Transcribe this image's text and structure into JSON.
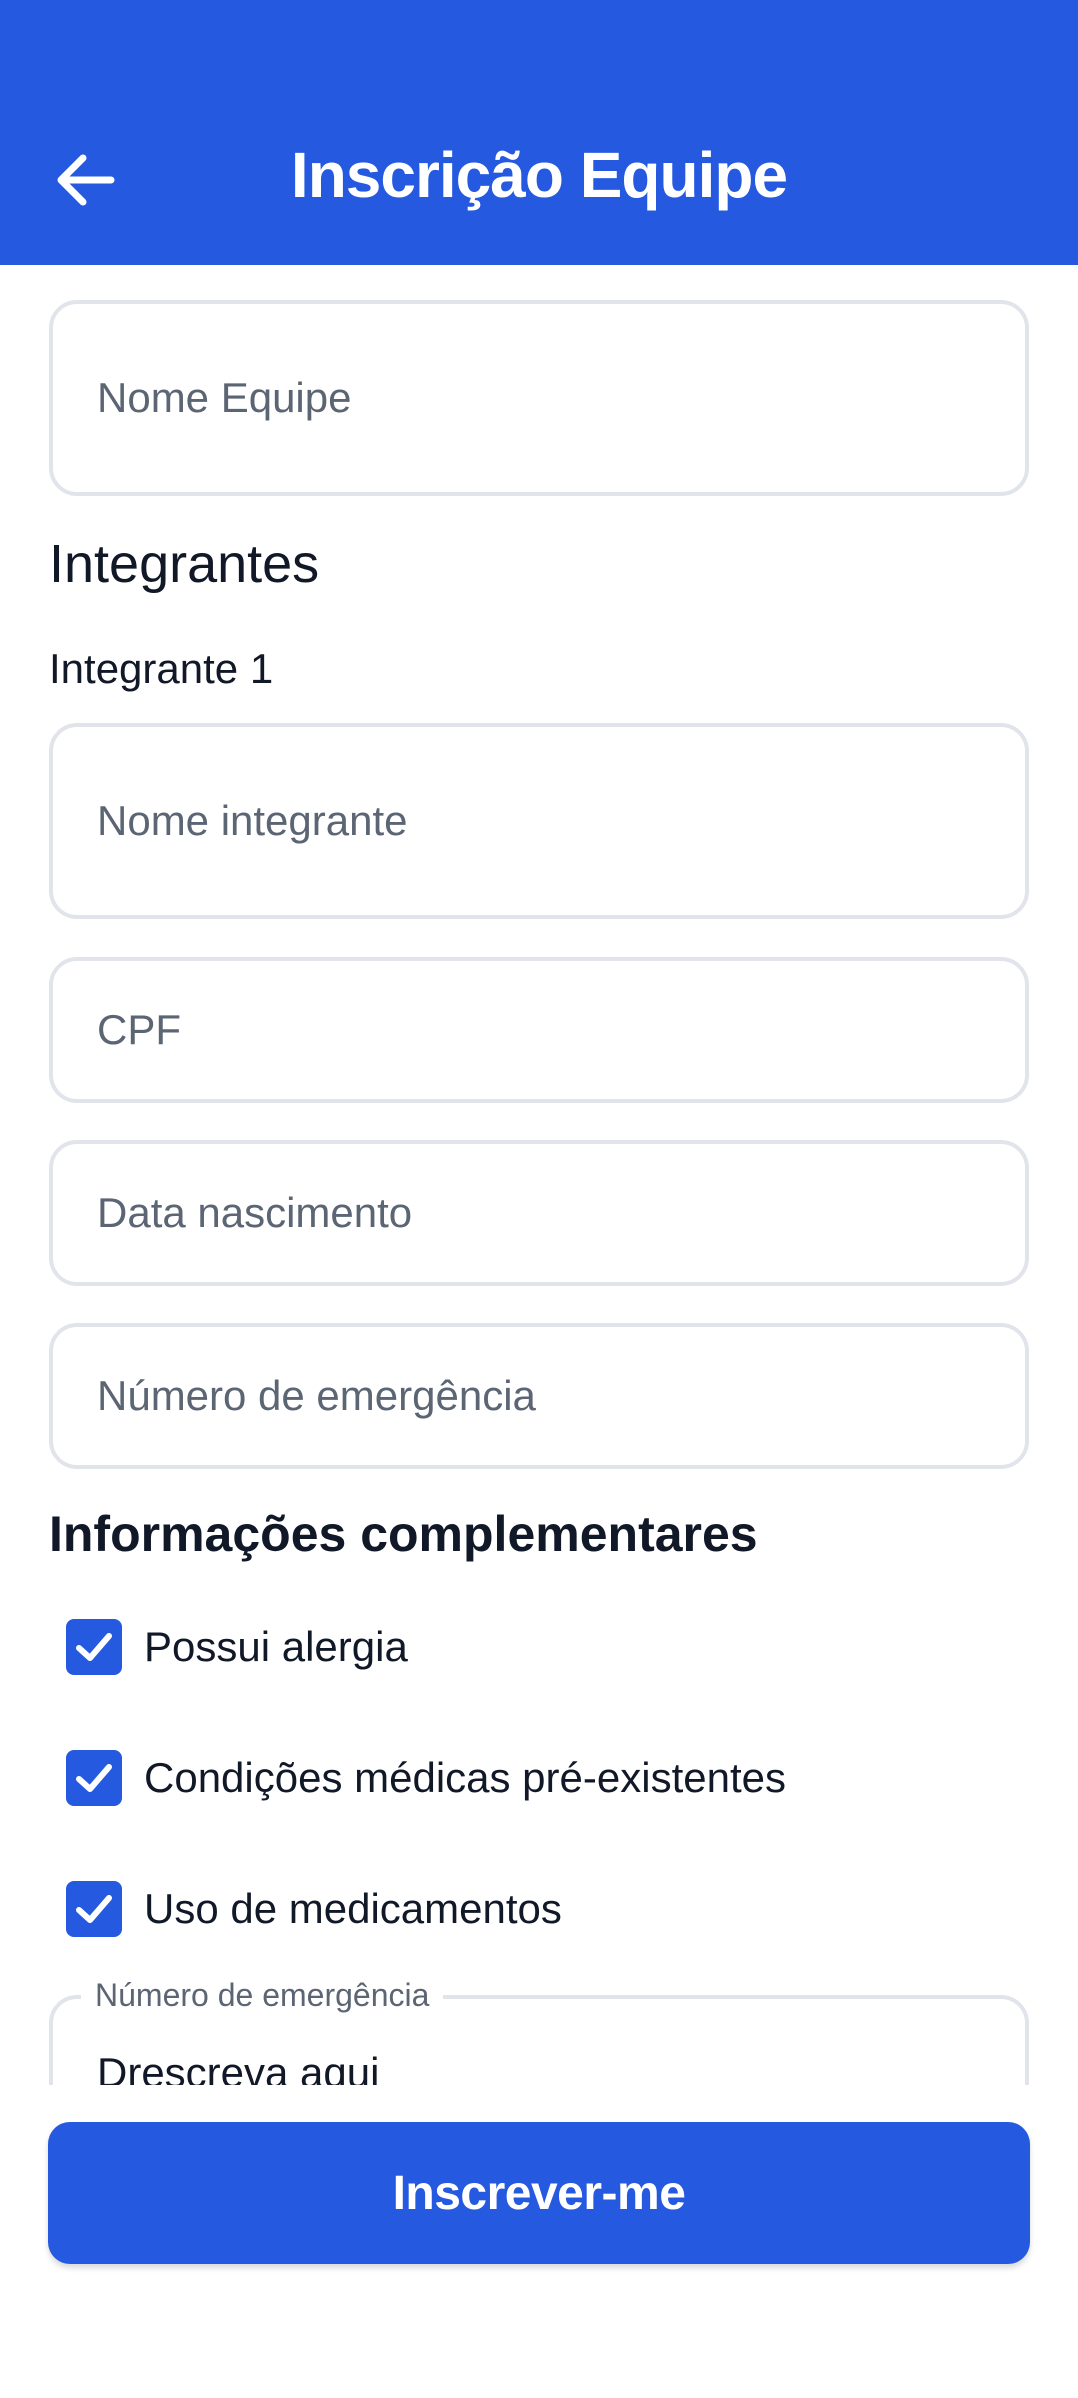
{
  "header": {
    "title": "Inscrição Equipe",
    "back_icon": "arrow-left-icon",
    "background": "#2459E0"
  },
  "form": {
    "team_name_placeholder": "Nome Equipe",
    "members_title": "Integrantes",
    "member_label": "Integrante 1",
    "member_name_placeholder": "Nome integrante",
    "cpf_placeholder": "CPF",
    "birth_date_placeholder": "Data nascimento",
    "emergency_number_placeholder": "Número de emergência"
  },
  "complementary": {
    "title": "Informações complementares",
    "options": [
      {
        "label": "Possui alergia",
        "checked": true
      },
      {
        "label": "Condições médicas pré-existentes",
        "checked": true
      },
      {
        "label": "Uso de medicamentos",
        "checked": true
      }
    ],
    "details_field": {
      "label": "Número de emergência",
      "value": "Drescreva aqui"
    }
  },
  "actions": {
    "submit_label": "Inscrever-me"
  },
  "colors": {
    "accent": "#2459E0",
    "border": "#E1E4EA",
    "placeholder": "#5B6573"
  }
}
